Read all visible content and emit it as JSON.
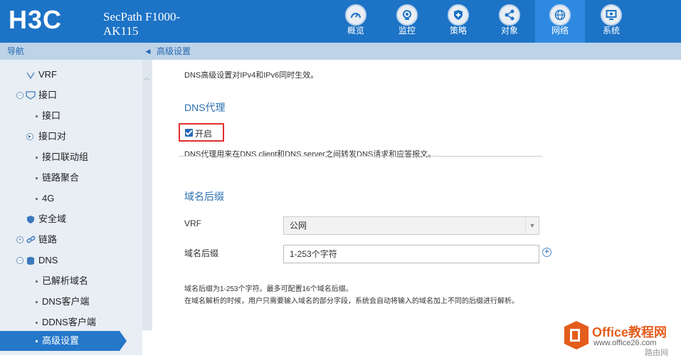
{
  "brand": {
    "logo_text": "H3C",
    "product": "SecPath F1000-AK115"
  },
  "nav_tabs": [
    {
      "label": "概览",
      "icon": "dashboard-icon",
      "active": false
    },
    {
      "label": "监控",
      "icon": "monitor-icon",
      "active": false
    },
    {
      "label": "策略",
      "icon": "shield-policy-icon",
      "active": false
    },
    {
      "label": "对象",
      "icon": "share-nodes-icon",
      "active": false
    },
    {
      "label": "网络",
      "icon": "globe-icon",
      "active": true
    },
    {
      "label": "系统",
      "icon": "system-display-icon",
      "active": false
    }
  ],
  "sidebar": {
    "title": "导航",
    "items": [
      {
        "label": "VRF"
      },
      {
        "label": "接口"
      },
      {
        "label": "接口"
      },
      {
        "label": "接口对"
      },
      {
        "label": "接口联动组"
      },
      {
        "label": "链路聚合"
      },
      {
        "label": "4G"
      },
      {
        "label": "安全域"
      },
      {
        "label": "链路"
      },
      {
        "label": "DNS"
      },
      {
        "label": "已解析域名"
      },
      {
        "label": "DNS客户端"
      },
      {
        "label": "DDNS客户端"
      },
      {
        "label": "高级设置"
      }
    ]
  },
  "breadcrumb": "高级设置",
  "content": {
    "intro": "DNS高级设置对IPv4和IPv6同时生效。",
    "proxy_title": "DNS代理",
    "proxy_checkbox_label": "开启",
    "proxy_checked": true,
    "proxy_desc": "DNS代理用来在DNS client和DNS server之间转发DNS请求和应答报文。",
    "suffix_title": "域名后缀",
    "vrf_label": "VRF",
    "vrf_value": "公网",
    "suffix_label": "域名后缀",
    "suffix_placeholder": "1-253个字符",
    "note1": "域名后缀为1-253个字符。最多可配置16个域名后缀。",
    "note2": "在域名解析的时候，用户只需要输入域名的部分字段，系统会自动将输入的域名加上不同的后缀进行解析。"
  },
  "watermark": {
    "line1": "Office教程网",
    "line2": "www.office26.com",
    "corner": "路由网"
  },
  "colors": {
    "header": "#1d73c6",
    "active_tab": "#2e8ae0",
    "highlight_border": "#e0302e"
  }
}
